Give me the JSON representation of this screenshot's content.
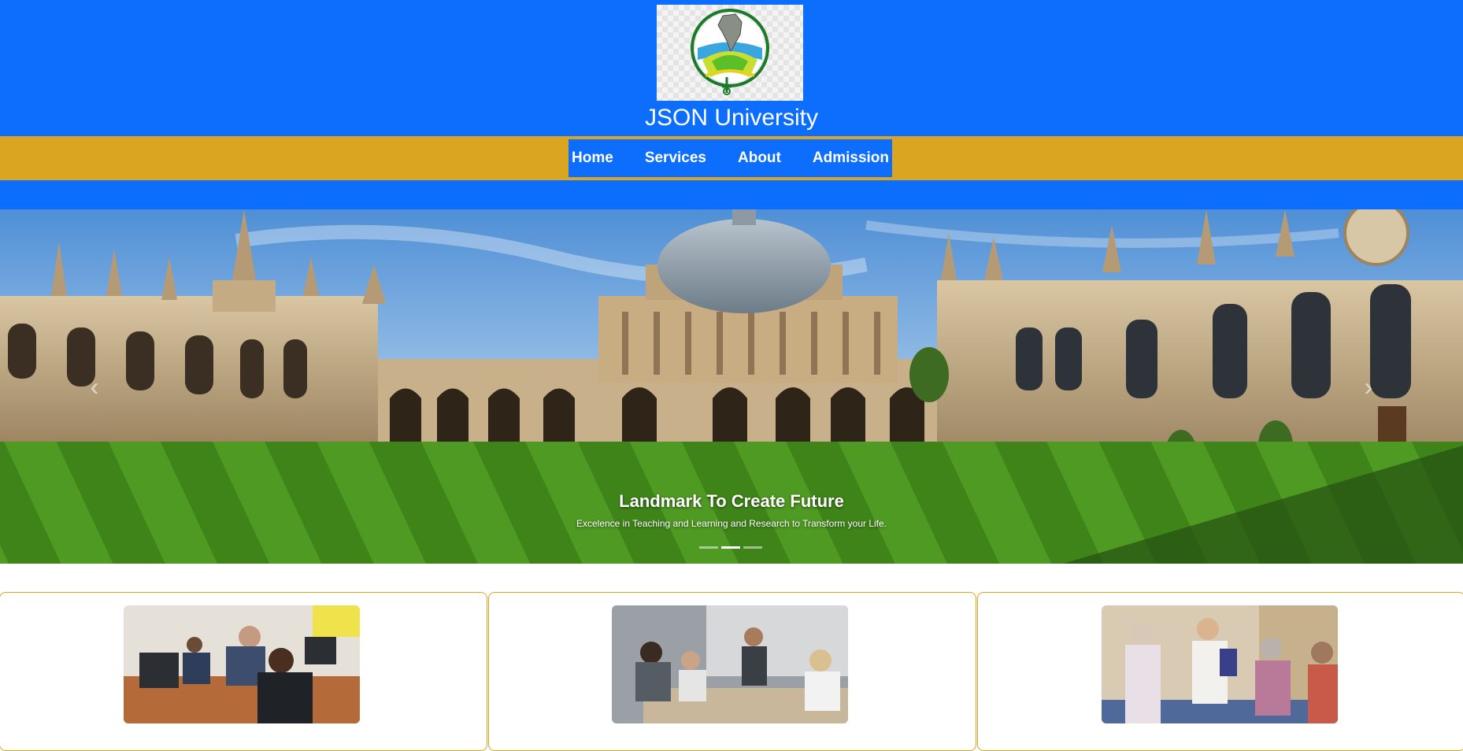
{
  "header": {
    "title": "JSON University",
    "logo_icon": "university-logo-icon",
    "background_color": "#0d6efd"
  },
  "nav": {
    "background_color": "#daa520",
    "items": [
      {
        "label": "Home"
      },
      {
        "label": "Services"
      },
      {
        "label": "About"
      },
      {
        "label": "Admission"
      }
    ]
  },
  "carousel": {
    "caption_title": "Landmark To Create Future",
    "caption_text": "Excelence in Teaching and Learning and Research to Transform your Life.",
    "prev_icon": "chevron-left-icon",
    "next_icon": "chevron-right-icon",
    "slide_count": 3,
    "active_slide": 2,
    "prev_glyph": "‹",
    "next_glyph": "›"
  },
  "cards": {
    "border_color": "#daa520",
    "items": [
      {
        "image": "students-computer-lab-photo"
      },
      {
        "image": "classroom-presentation-photo"
      },
      {
        "image": "care-group-discussion-photo"
      }
    ]
  }
}
